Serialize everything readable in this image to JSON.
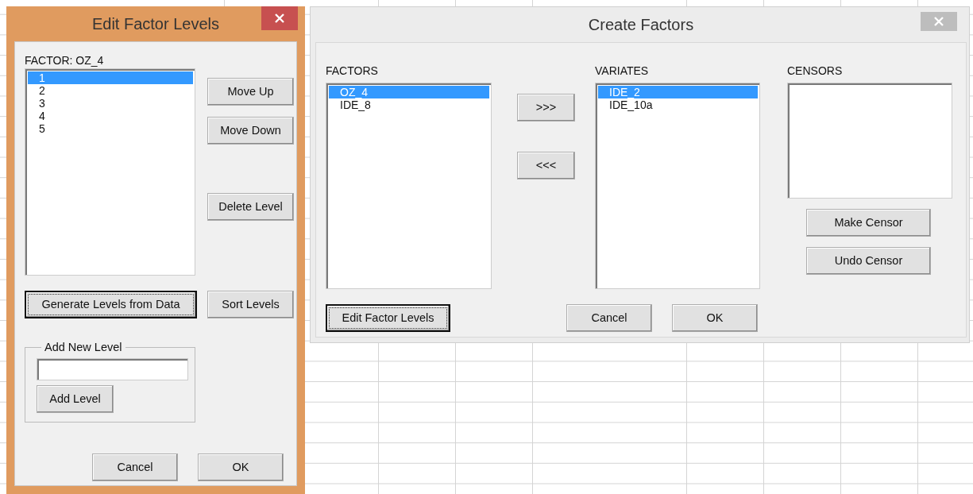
{
  "edit_dialog": {
    "title": "Edit Factor Levels",
    "factor_label": "FACTOR: OZ_4",
    "levels": [
      {
        "label": "1",
        "selected": true
      },
      {
        "label": "2",
        "selected": false
      },
      {
        "label": "3",
        "selected": false
      },
      {
        "label": "4",
        "selected": false
      },
      {
        "label": "5",
        "selected": false
      }
    ],
    "side_buttons": [
      {
        "label": "Move Up",
        "focused": false
      },
      {
        "label": "Move Down",
        "focused": false
      },
      {
        "label": "Delete Level",
        "focused": false
      }
    ],
    "generate_button": {
      "label": "Generate Levels from Data",
      "focused": true
    },
    "sort_button": {
      "label": "Sort Levels",
      "focused": false
    },
    "add_group": {
      "legend": "Add New Level",
      "button": {
        "label": "Add Level",
        "focused": false
      }
    },
    "footer_buttons": [
      {
        "label": "Cancel",
        "focused": false
      },
      {
        "label": "OK",
        "focused": false
      }
    ]
  },
  "create_dialog": {
    "title": "Create Factors",
    "lists": [
      {
        "label": "FACTORS",
        "items": [
          {
            "label": "OZ_4",
            "selected": true
          },
          {
            "label": "IDE_8",
            "selected": false
          }
        ]
      },
      {
        "label": "VARIATES",
        "items": [
          {
            "label": "IDE_2",
            "selected": true
          },
          {
            "label": "IDE_10a",
            "selected": false
          }
        ]
      },
      {
        "label": "CENSORS"
      }
    ],
    "transfer_buttons": [
      {
        "label": ">>>",
        "focused": false
      },
      {
        "label": "<<<",
        "focused": false
      }
    ],
    "censor_buttons": [
      {
        "label": "Make Censor",
        "focused": false
      },
      {
        "label": "Undo Censor",
        "focused": false
      }
    ],
    "edit_levels_button": {
      "label": "Edit Factor Levels",
      "focused": true
    },
    "footer_buttons": [
      {
        "label": "Cancel",
        "focused": false
      },
      {
        "label": "OK",
        "focused": false
      }
    ]
  }
}
